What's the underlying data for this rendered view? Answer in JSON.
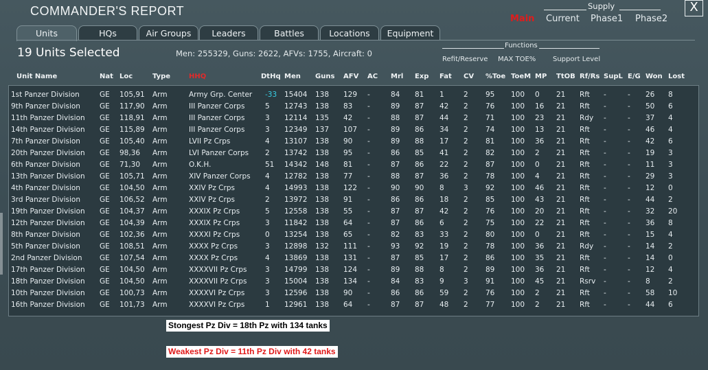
{
  "window": {
    "title": "COMMANDER'S REPORT",
    "close_label": "X"
  },
  "supply": {
    "title": "Supply",
    "options": [
      "Main",
      "Current",
      "Phase1",
      "Phase2"
    ]
  },
  "tabs": [
    "Units",
    "HQs",
    "Air Groups",
    "Leaders",
    "Battles",
    "Locations",
    "Equipment"
  ],
  "summary": {
    "selected": "19 Units Selected",
    "totals": "Men: 255329, Guns: 2622, AFVs: 1755, Aircraft: 0"
  },
  "functions": {
    "title": "Functions",
    "items": [
      "Refit/Reserve",
      "MAX TOE%",
      "Support Level"
    ]
  },
  "table": {
    "headers": [
      "Unit Name",
      "Nat",
      "Loc",
      "Type",
      "HHQ",
      "DtHq",
      "Men",
      "Guns",
      "AFV",
      "AC",
      "Mrl",
      "Exp",
      "Fat",
      "CV",
      "%Toe",
      "ToeM",
      "MP",
      "TtOB",
      "Rf/Rs",
      "SupL",
      "E/G",
      "Won",
      "Lost"
    ],
    "rows": [
      [
        "1st Panzer Division",
        "GE",
        "105,91",
        "Arm",
        "Army Grp. Center",
        "-33",
        "15404",
        "138",
        "129",
        "-",
        "84",
        "81",
        "1",
        "2",
        "95",
        "100",
        "0",
        "21",
        "Rft",
        "-",
        "-",
        "26",
        "8"
      ],
      [
        "9th Panzer Division",
        "GE",
        "117,90",
        "Arm",
        "III Panzer Corps",
        "5",
        "12743",
        "138",
        "83",
        "-",
        "89",
        "87",
        "42",
        "2",
        "76",
        "100",
        "16",
        "21",
        "Rft",
        "-",
        "-",
        "50",
        "6"
      ],
      [
        "11th Panzer Division",
        "GE",
        "118,91",
        "Arm",
        "III Panzer Corps",
        "3",
        "12114",
        "135",
        "42",
        "-",
        "88",
        "87",
        "44",
        "2",
        "71",
        "100",
        "23",
        "21",
        "Rdy",
        "-",
        "-",
        "37",
        "4"
      ],
      [
        "14th Panzer Division",
        "GE",
        "115,89",
        "Arm",
        "III Panzer Corps",
        "3",
        "12349",
        "137",
        "107",
        "-",
        "89",
        "86",
        "34",
        "2",
        "74",
        "100",
        "13",
        "21",
        "Rft",
        "-",
        "-",
        "46",
        "4"
      ],
      [
        "7th Panzer Division",
        "GE",
        "105,40",
        "Arm",
        "LVII Pz Crps",
        "4",
        "13107",
        "138",
        "90",
        "-",
        "89",
        "88",
        "17",
        "2",
        "81",
        "100",
        "36",
        "21",
        "Rft",
        "-",
        "-",
        "42",
        "6"
      ],
      [
        "20th Panzer Division",
        "GE",
        "98,36",
        "Arm",
        "LVI Panzer Corps",
        "2",
        "13742",
        "138",
        "95",
        "-",
        "86",
        "85",
        "41",
        "2",
        "82",
        "100",
        "2",
        "21",
        "Rft",
        "-",
        "-",
        "19",
        "3"
      ],
      [
        "6th Panzer Division",
        "GE",
        "71,30",
        "Arm",
        "O.K.H.",
        "51",
        "14342",
        "148",
        "81",
        "-",
        "87",
        "86",
        "22",
        "2",
        "87",
        "100",
        "0",
        "21",
        "Rft",
        "-",
        "-",
        "11",
        "3"
      ],
      [
        "13th Panzer Division",
        "GE",
        "105,71",
        "Arm",
        "XIV Panzer Corps",
        "4",
        "12782",
        "138",
        "77",
        "-",
        "88",
        "87",
        "36",
        "2",
        "78",
        "100",
        "4",
        "21",
        "Rft",
        "-",
        "-",
        "29",
        "3"
      ],
      [
        "4th Panzer Division",
        "GE",
        "104,50",
        "Arm",
        "XXIV Pz Crps",
        "4",
        "14993",
        "138",
        "122",
        "-",
        "90",
        "90",
        "8",
        "3",
        "92",
        "100",
        "46",
        "21",
        "Rft",
        "-",
        "-",
        "12",
        "0"
      ],
      [
        "3rd Panzer Division",
        "GE",
        "106,52",
        "Arm",
        "XXIV Pz Crps",
        "2",
        "13972",
        "138",
        "91",
        "-",
        "86",
        "86",
        "18",
        "2",
        "85",
        "100",
        "43",
        "21",
        "Rft",
        "-",
        "-",
        "44",
        "2"
      ],
      [
        "19th Panzer Division",
        "GE",
        "104,37",
        "Arm",
        "XXXIX Pz Crps",
        "5",
        "12558",
        "138",
        "55",
        "-",
        "87",
        "87",
        "42",
        "2",
        "76",
        "100",
        "20",
        "21",
        "Rft",
        "-",
        "-",
        "32",
        "20"
      ],
      [
        "12th Panzer Division",
        "GE",
        "104,39",
        "Arm",
        "XXXIX Pz Crps",
        "3",
        "11842",
        "138",
        "64",
        "-",
        "87",
        "86",
        "6",
        "2",
        "75",
        "100",
        "22",
        "21",
        "Rft",
        "-",
        "-",
        "36",
        "8"
      ],
      [
        "8th Panzer Division",
        "GE",
        "102,36",
        "Arm",
        "XXXXI Pz Crps",
        "0",
        "13254",
        "138",
        "65",
        "-",
        "82",
        "83",
        "33",
        "2",
        "80",
        "100",
        "0",
        "21",
        "Rft",
        "-",
        "-",
        "15",
        "4"
      ],
      [
        "5th Panzer Division",
        "GE",
        "108,51",
        "Arm",
        "XXXX Pz Crps",
        "3",
        "12898",
        "132",
        "111",
        "-",
        "93",
        "92",
        "19",
        "2",
        "78",
        "100",
        "36",
        "21",
        "Rdy",
        "-",
        "-",
        "14",
        "2"
      ],
      [
        "2nd Panzer Division",
        "GE",
        "107,54",
        "Arm",
        "XXXX Pz Crps",
        "4",
        "13869",
        "138",
        "131",
        "-",
        "87",
        "85",
        "17",
        "2",
        "86",
        "100",
        "35",
        "21",
        "Rft",
        "-",
        "-",
        "14",
        "0"
      ],
      [
        "17th Panzer Division",
        "GE",
        "104,50",
        "Arm",
        "XXXXVII Pz Crps",
        "3",
        "14799",
        "138",
        "124",
        "-",
        "89",
        "88",
        "8",
        "2",
        "89",
        "100",
        "36",
        "21",
        "Rft",
        "-",
        "-",
        "12",
        "4"
      ],
      [
        "18th Panzer Division",
        "GE",
        "104,50",
        "Arm",
        "XXXXVII Pz Crps",
        "3",
        "15004",
        "138",
        "134",
        "-",
        "84",
        "83",
        "9",
        "3",
        "91",
        "100",
        "45",
        "21",
        "Rsrv",
        "-",
        "-",
        "8",
        "2"
      ],
      [
        "10th Panzer Division",
        "GE",
        "100,73",
        "Arm",
        "XXXXVI Pz Crps",
        "3",
        "12596",
        "138",
        "90",
        "-",
        "86",
        "86",
        "59",
        "2",
        "76",
        "100",
        "2",
        "21",
        "Rft",
        "-",
        "-",
        "58",
        "10"
      ],
      [
        "16th Panzer Division",
        "GE",
        "101,73",
        "Arm",
        "XXXXVI Pz Crps",
        "1",
        "12961",
        "138",
        "64",
        "-",
        "87",
        "87",
        "48",
        "2",
        "77",
        "100",
        "2",
        "21",
        "Rft",
        "-",
        "-",
        "44",
        "6"
      ]
    ]
  },
  "annotations": {
    "strongest": "Stongest Pz Div = 18th Pz  with 134 tanks",
    "weakest": "Weakest Pz Div = 11th Pz Div with 42 tanks"
  },
  "colors": {
    "background": "#3e5058",
    "panel": "#2b3a40",
    "highlight_red": "#e01c1c",
    "dthq_cyan": "#38d0e6"
  }
}
